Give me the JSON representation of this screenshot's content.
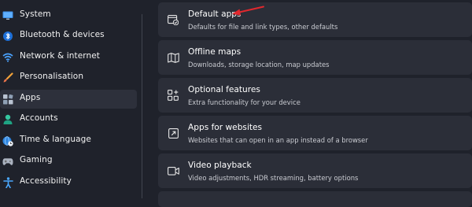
{
  "sidebar": {
    "items": [
      {
        "label": "System",
        "icon": "monitor-icon"
      },
      {
        "label": "Bluetooth & devices",
        "icon": "bluetooth-icon"
      },
      {
        "label": "Network & internet",
        "icon": "wifi-icon"
      },
      {
        "label": "Personalisation",
        "icon": "brush-icon"
      },
      {
        "label": "Apps",
        "icon": "apps-icon",
        "selected": true
      },
      {
        "label": "Accounts",
        "icon": "person-icon"
      },
      {
        "label": "Time & language",
        "icon": "globe-clock-icon"
      },
      {
        "label": "Gaming",
        "icon": "gamepad-icon"
      },
      {
        "label": "Accessibility",
        "icon": "accessibility-icon"
      }
    ]
  },
  "main": {
    "cards": [
      {
        "title": "Default apps",
        "description": "Defaults for file and link types, other defaults",
        "icon": "default-apps-icon"
      },
      {
        "title": "Offline maps",
        "description": "Downloads, storage location, map updates",
        "icon": "map-icon"
      },
      {
        "title": "Optional features",
        "description": "Extra functionality for your device",
        "icon": "optional-features-icon"
      },
      {
        "title": "Apps for websites",
        "description": "Websites that can open in an app instead of a browser",
        "icon": "web-link-icon"
      },
      {
        "title": "Video playback",
        "description": "Video adjustments, HDR streaming, battery options",
        "icon": "video-icon"
      }
    ]
  },
  "colors": {
    "background": "#1f222b",
    "card": "#2b2e38",
    "selected": "#2d303b",
    "annotation_arrow": "#e0282e",
    "accent": "#4cc2ff"
  }
}
